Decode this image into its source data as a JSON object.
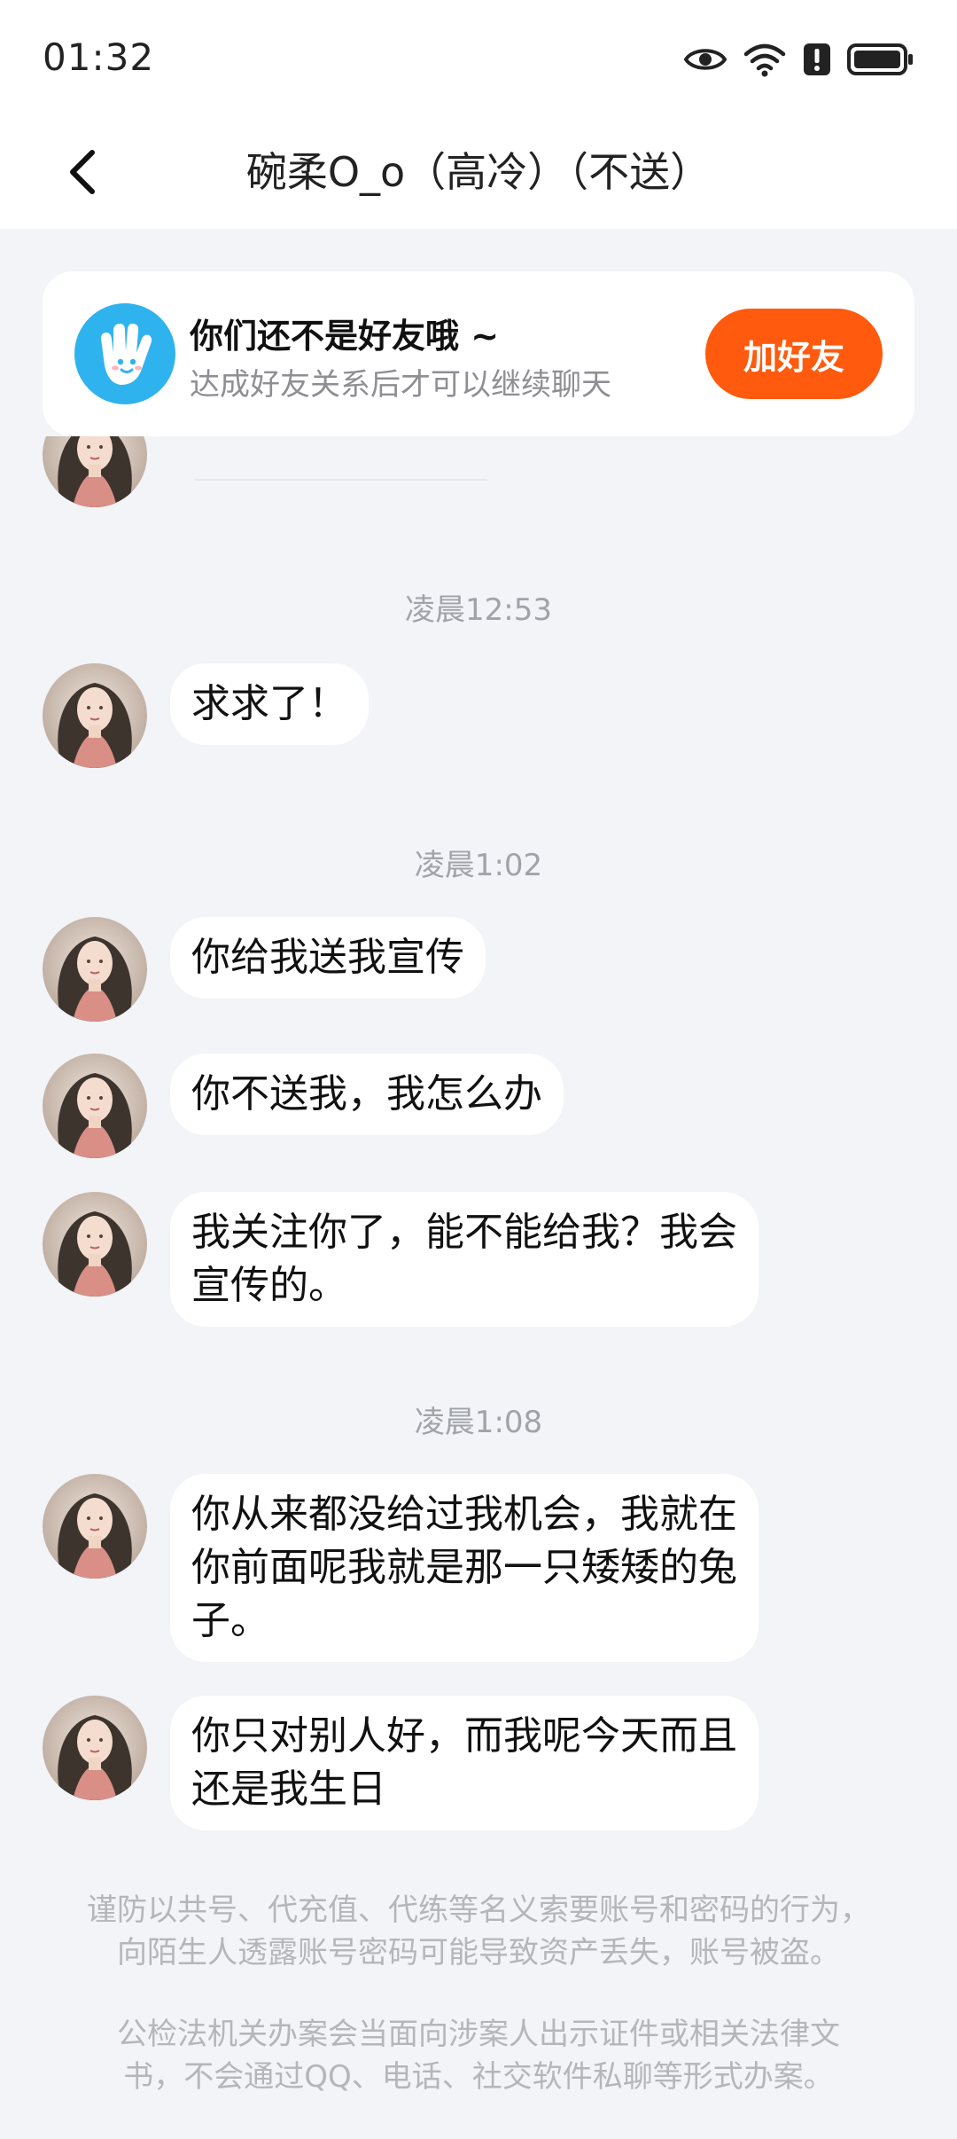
{
  "status_bar": {
    "time": "01:32",
    "icons": [
      "eye-icon",
      "wifi-icon",
      "alert-icon",
      "battery-icon"
    ]
  },
  "nav": {
    "title": "碗柔O_o（高冷）（不送）",
    "back_icon": "chevron-left-icon"
  },
  "friend_banner": {
    "title": "你们还不是好友哦 ~",
    "subtitle": "达成好友关系后才可以继续聊天",
    "button_label": "加好友",
    "logo_icon": "hand-logo-icon",
    "accent_color": "#ff5a0e"
  },
  "chat": {
    "timestamps": [
      "凌晨12:53",
      "凌晨1:02",
      "凌晨1:08"
    ],
    "messages": [
      {
        "text": "求求了！"
      },
      {
        "text": "你给我送我宣传"
      },
      {
        "text": "你不送我，我怎么办"
      },
      {
        "line1": "我关注你了，能不能给我？我会",
        "line2": "宣传的。"
      },
      {
        "line1": "你从来都没给过我机会，我就在",
        "line2": "你前面呢我就是那一只矮矮的兔",
        "line3": "子。"
      },
      {
        "line1": "你只对别人好，而我呢今天而且",
        "line2": "还是我生日"
      }
    ]
  },
  "notices": {
    "n1_line1": "谨防以共号、代充值、代练等名义索要账号和密码的行为，",
    "n1_line2": "向陌生人透露账号密码可能导致资产丢失，账号被盗。",
    "n2_line1": "公检法机关办案会当面向涉案人出示证件或相关法律文",
    "n2_line2": "书，不会通过QQ、电话、社交软件私聊等形式办案。"
  }
}
